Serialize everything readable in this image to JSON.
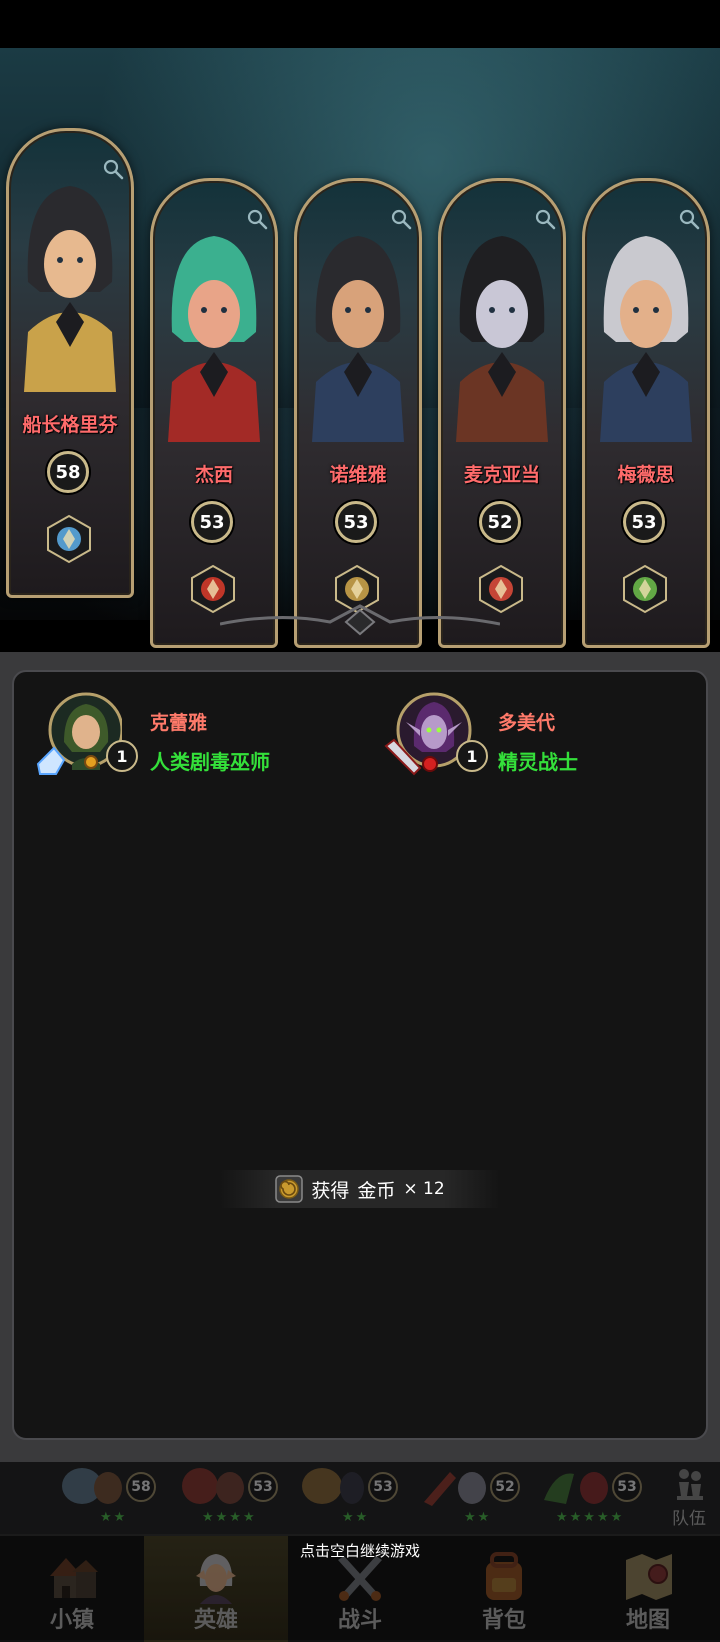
{
  "heroes": [
    {
      "name": "船长格里芬",
      "level": "58",
      "class_icon": "orb-staff-icon",
      "hair": "#2a2a2e",
      "skin": "#e7b98f",
      "outfit": "#c9a24a"
    },
    {
      "name": "杰西",
      "level": "53",
      "class_icon": "shield-icon",
      "hair": "#3bb08f",
      "skin": "#e8a488",
      "outfit": "#a32a26"
    },
    {
      "name": "诺维雅",
      "level": "53",
      "class_icon": "winged-emblem-icon",
      "hair": "#2a2a2e",
      "skin": "#d8a27a",
      "outfit": "#2d3f5e"
    },
    {
      "name": "麦克亚当",
      "level": "52",
      "class_icon": "sword-icon",
      "hair": "#1f1f22",
      "skin": "#c9c7d6",
      "outfit": "#6b3524"
    },
    {
      "name": "梅薇思",
      "level": "53",
      "class_icon": "bow-icon",
      "hair": "#c9c9cf",
      "skin": "#e3b08a",
      "outfit": "#2d3f5e"
    }
  ],
  "recruits": [
    {
      "name": "克蕾雅",
      "class": "人类剧毒巫师",
      "level": "1"
    },
    {
      "name": "多美代",
      "class": "精灵战士",
      "level": "1"
    }
  ],
  "toast": {
    "prefix": "获得",
    "item": "金币",
    "count": "× 12"
  },
  "team": {
    "slots": [
      {
        "level": "58",
        "stars": "★★"
      },
      {
        "level": "53",
        "stars": "★★★★"
      },
      {
        "level": "53",
        "stars": "★★"
      },
      {
        "level": "52",
        "stars": "★★"
      },
      {
        "level": "53",
        "stars": "★★★★★"
      }
    ],
    "label": "队伍"
  },
  "nav": {
    "items": [
      {
        "label": "小镇",
        "icon": "town-icon"
      },
      {
        "label": "英雄",
        "icon": "hero-icon"
      },
      {
        "label": "战斗",
        "icon": "battle-icon"
      },
      {
        "label": "背包",
        "icon": "backpack-icon"
      },
      {
        "label": "地图",
        "icon": "map-icon"
      }
    ],
    "active": "英雄"
  },
  "continue_hint": "点击空白继续游戏",
  "colors": {
    "hero_name": "#ff6b6b",
    "recruit_name": "#ff7a6a",
    "recruit_class": "#34e03a",
    "frame_gold": "#b79f73"
  }
}
